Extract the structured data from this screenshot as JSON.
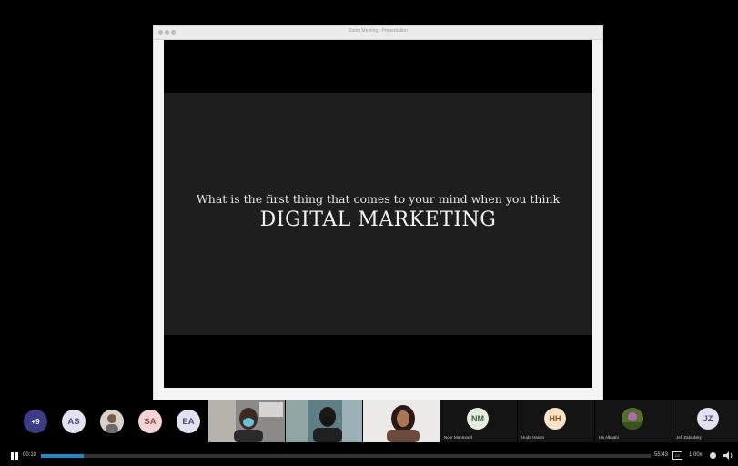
{
  "shared_window": {
    "title": "Zoom Meeting - Presentation",
    "slide_subtitle": "What is the first thing that comes to your mind when you think",
    "slide_title": "DIGITAL MARKETING"
  },
  "participants": {
    "more_count": "+9",
    "avatars": [
      {
        "initials": "AS"
      },
      {
        "initials": "SA"
      },
      {
        "initials": "EA"
      }
    ],
    "tiles": [
      {
        "initials": "NM",
        "name": "Noor Mahmoud"
      },
      {
        "initials": "HH",
        "name": "Huda Hasan"
      },
      {
        "initials": "",
        "name": "Isa Alkaabi"
      },
      {
        "initials": "JZ",
        "name": "Jeff Zabudsky"
      }
    ]
  },
  "player": {
    "current_time": "00:10",
    "duration": "55:43",
    "speed": "1.00x",
    "progress_fraction": 0.07,
    "accent": "#1f89c7"
  }
}
